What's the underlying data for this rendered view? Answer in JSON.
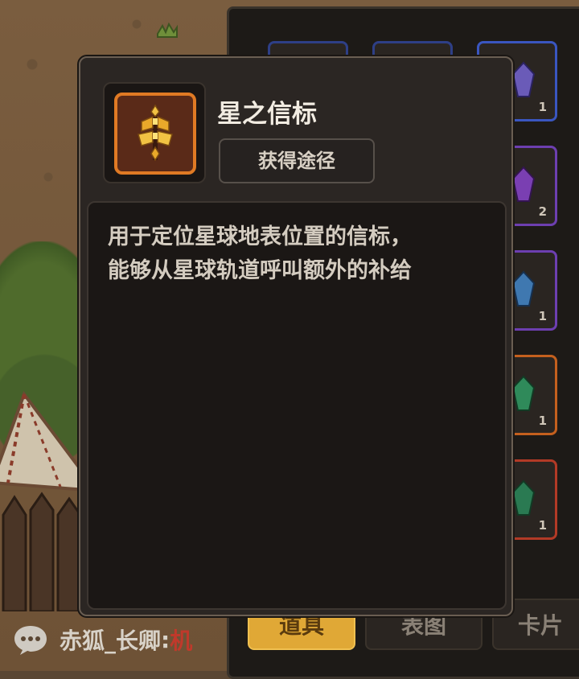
{
  "item": {
    "name": "星之信标",
    "source_button": "获得途径",
    "description_lines": [
      "用于定位星球地表位置的信标，",
      "能够从星球轨道呼叫额外的补给"
    ],
    "icon": "beacon-icon"
  },
  "inventory": {
    "slot_counts": [
      "1",
      "2",
      "1",
      "1",
      "1"
    ],
    "gem_icons": [
      "purple-crystal-icon",
      "purple-crystal-icon",
      "blue-crystal-icon",
      "green-crystal-icon",
      "green-crystal-icon"
    ],
    "tabs": [
      "道具",
      "表图",
      "卡片"
    ]
  },
  "chat": {
    "sender": "赤狐_长卿",
    "colon": ":",
    "message": "机"
  },
  "colors": {
    "tooltip_bg": "#2b2623",
    "accent_orange": "#e07a24",
    "active_tab": "#e0a836",
    "chat_message": "#c0392b"
  }
}
